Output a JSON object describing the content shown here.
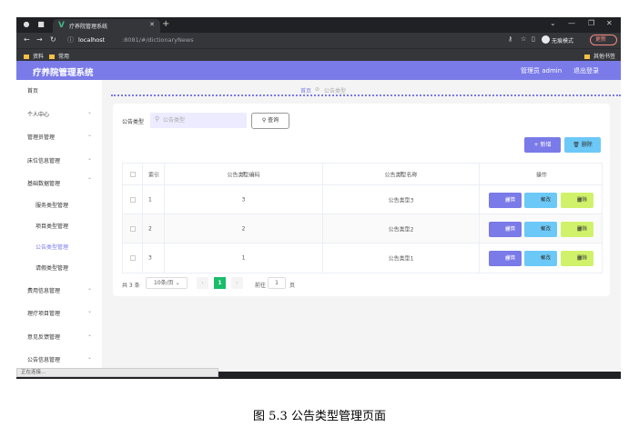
{
  "browser": {
    "tab_title": "疗养院管理系统",
    "url_host": "localhost",
    "url_rest": ":8081/#/dictionaryNews",
    "profile_label": "无痕模式",
    "update_label": "更新",
    "bookmarks": [
      "资料",
      "常用"
    ],
    "other_bookmarks": "其他书签"
  },
  "header": {
    "app_title": "疗养院管理系统",
    "admin": "管理员 admin",
    "logout": "退出登录",
    "accent_color": "#7a7ae8"
  },
  "sidebar": {
    "home": "首页",
    "personal": "个人中心",
    "admin_mgmt": "管理员管理",
    "bed_mgmt": "床位信息管理",
    "base_data": "基础数据管理",
    "sub_items": [
      "服务类型管理",
      "项目类型管理",
      "公告类型管理",
      "请假类型管理"
    ],
    "fee_mgmt": "费用信息管理",
    "therapy_mgmt": "理疗项目管理",
    "feedback_mgmt": "意见反馈管理",
    "notice_mgmt": "公告信息管理"
  },
  "breadcrumb": {
    "home": "首页",
    "current": "公告类型"
  },
  "search": {
    "label": "公告类型",
    "placeholder": "公告类型",
    "query_label": "查询"
  },
  "actions": {
    "add": "新增",
    "delete": "删除"
  },
  "table": {
    "headers": {
      "index": "索引",
      "code": "公告类型编码",
      "name": "公告类型名称",
      "ops": "操作"
    },
    "rows": [
      {
        "index": "1",
        "code": "3",
        "name": "公告类型3"
      },
      {
        "index": "2",
        "code": "2",
        "name": "公告类型2"
      },
      {
        "index": "3",
        "code": "1",
        "name": "公告类型1"
      }
    ],
    "op_labels": {
      "detail": "详情",
      "edit": "修改",
      "delete": "删除"
    }
  },
  "pagination": {
    "total": "共 3 条",
    "page_size": "10条/页",
    "current_page": "1",
    "goto_label": "前往",
    "goto_value": "1",
    "page_suffix": "页"
  },
  "statusbar": "正在连接...",
  "caption": "图 5.3  公告类型管理页面"
}
